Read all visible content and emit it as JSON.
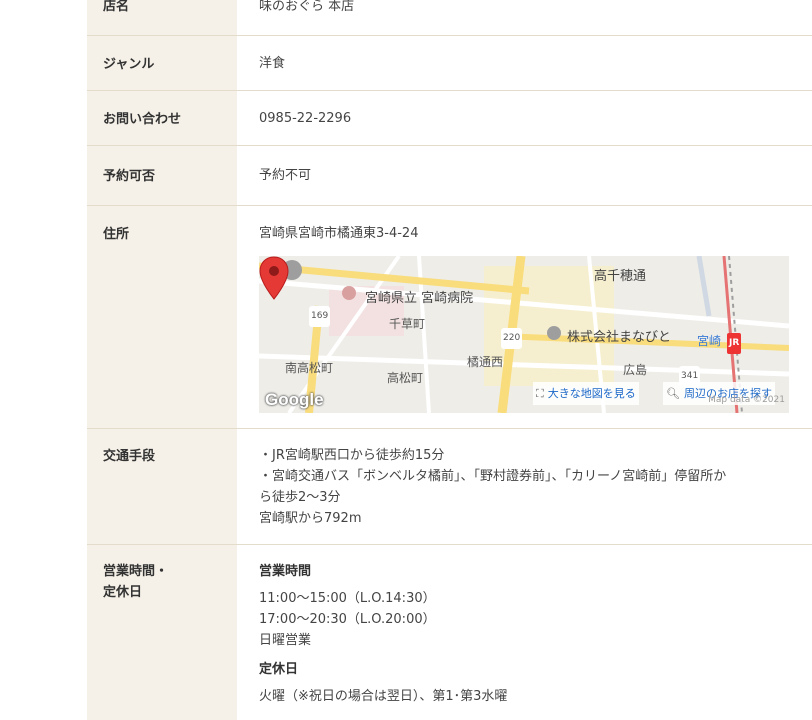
{
  "rows": {
    "name": {
      "label": "店名",
      "value": "味のおぐら 本店"
    },
    "genre": {
      "label": "ジャンル",
      "value": "洋食"
    },
    "contact": {
      "label": "お問い合わせ",
      "value": "0985-22-2296"
    },
    "reservation": {
      "label": "予約可否",
      "value": "予約不可"
    },
    "address": {
      "label": "住所",
      "value": "宮崎県宮崎市橘通東3-4-24"
    },
    "access": {
      "label": "交通手段",
      "lines": [
        "・JR宮崎駅西口から徒歩約15分",
        "・宮崎交通バス「ボンベルタ橘前」、「野村證券前」、「カリーノ宮崎前」停留所か",
        "ら徒歩2～3分",
        "宮崎駅から792m"
      ]
    },
    "hours": {
      "label_line1": "営業時間・",
      "label_line2": "定休日",
      "hours_heading": "営業時間",
      "hours_lines": [
        "11:00～15:00（L.O.14:30）",
        "17:00～20:30（L.O.20:00）",
        "日曜営業"
      ],
      "closed_heading": "定休日",
      "closed_value": "火曜（※祝日の場合は翌日）、第1･第3水曜"
    }
  },
  "map": {
    "labels": {
      "takachiho": "高千穂通",
      "hospital": "宮崎県立 宮崎病院",
      "chigusa": "千草町",
      "company": "株式会社まなびと",
      "miyazaki": "宮崎",
      "minami": "南高松町",
      "tachibana": "橘通西",
      "takamatsu": "高松町",
      "hiroshima": "広島",
      "route_169": "169",
      "route_220": "220",
      "route_341": "341",
      "jr": "JR"
    },
    "big_map_link": "大きな地図を見る",
    "nearby_link": "周辺のお店を探す",
    "google": "Google",
    "map_data": "Map data ©2021",
    "colors": {
      "road_major": "#f9dc7c",
      "pin": "#e53935",
      "station_line": "#e57373"
    }
  }
}
